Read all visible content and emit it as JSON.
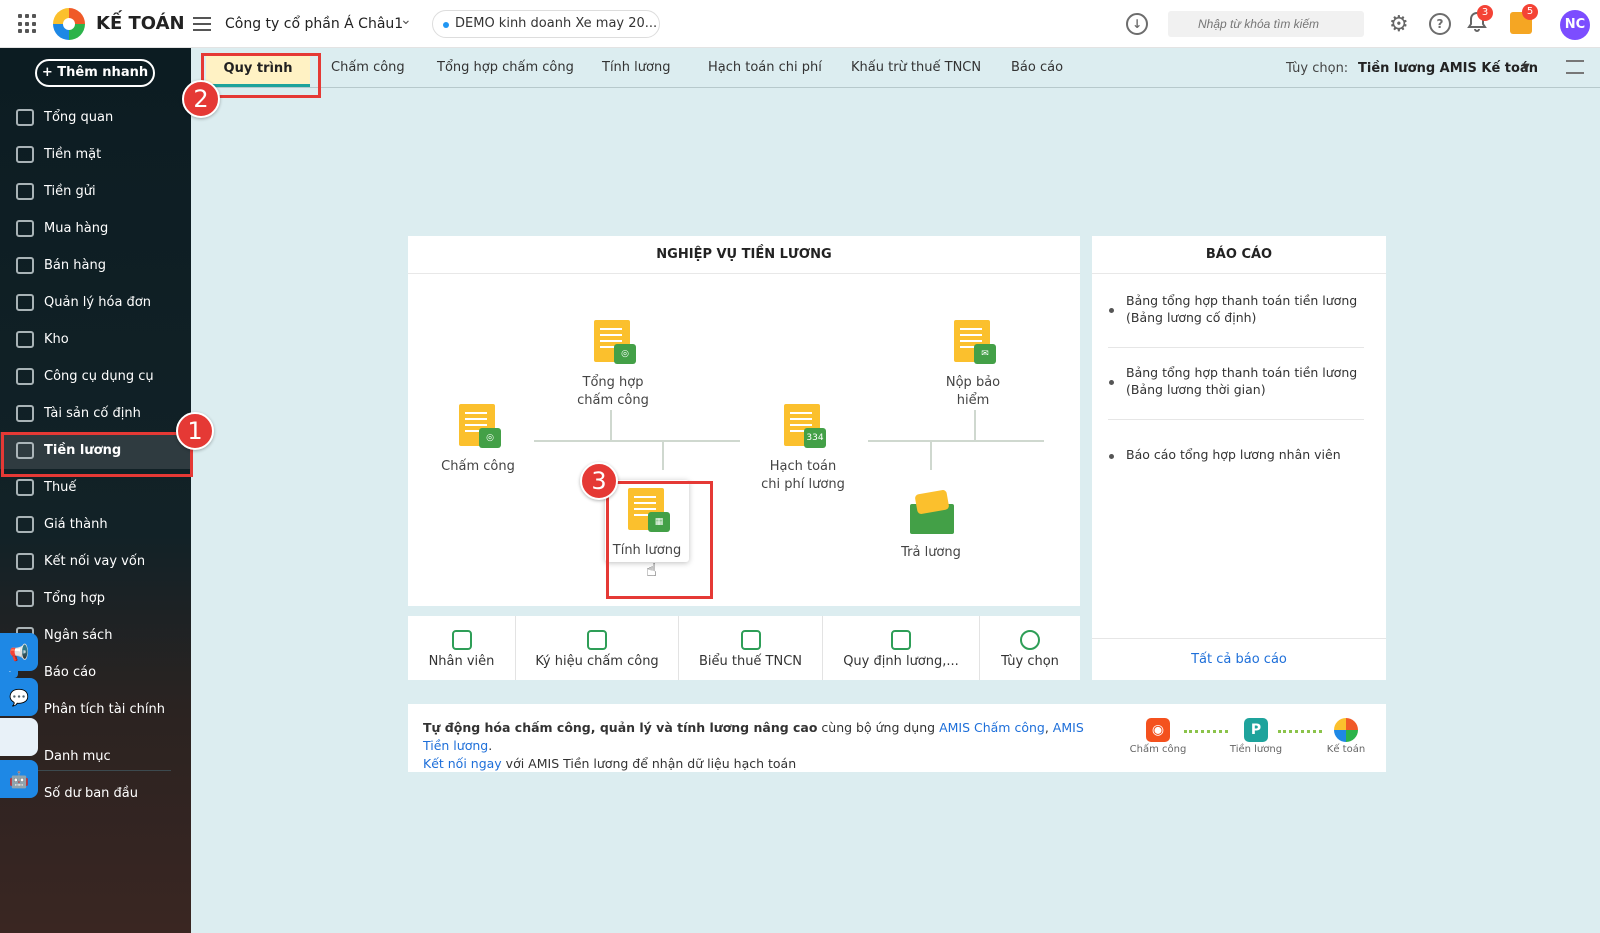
{
  "app": {
    "brand": "KẾ TOÁN",
    "company": "Công ty cổ phần Á Châu1",
    "demo_db": "DEMO kinh doanh Xe may 20..."
  },
  "search": {
    "placeholder": "Nhập từ khóa tìm kiếm"
  },
  "badges": {
    "notifications": "3",
    "gifts": "5"
  },
  "user": {
    "initials": "NC"
  },
  "sidebar": {
    "quick_add": "+ Thêm nhanh",
    "items": [
      {
        "label": "Tổng quan"
      },
      {
        "label": "Tiền mặt"
      },
      {
        "label": "Tiền gửi"
      },
      {
        "label": "Mua hàng"
      },
      {
        "label": "Bán hàng"
      },
      {
        "label": "Quản lý hóa đơn"
      },
      {
        "label": "Kho"
      },
      {
        "label": "Công cụ dụng cụ"
      },
      {
        "label": "Tài sản cố định"
      },
      {
        "label": "Tiền lương"
      },
      {
        "label": "Thuế"
      },
      {
        "label": "Giá thành"
      },
      {
        "label": "Kết nối vay vốn"
      },
      {
        "label": "Tổng hợp"
      },
      {
        "label": "Ngân sách"
      },
      {
        "label": "Báo cáo"
      },
      {
        "label": "Phân tích tài chính"
      },
      {
        "label": "Danh mục"
      },
      {
        "label": "Số dư ban đầu"
      }
    ]
  },
  "tabs": [
    "Quy trình",
    "Chấm công",
    "Tổng hợp chấm công",
    "Tính lương",
    "Hạch toán chi phí",
    "Khấu trừ thuế TNCN",
    "Báo cáo"
  ],
  "options": {
    "label": "Tùy chọn:",
    "value": "Tiền lương AMIS Kế toán"
  },
  "steps": [
    "1",
    "2",
    "3"
  ],
  "workflow": {
    "title": "NGHIỆP VỤ TIỀN LƯƠNG",
    "nodes": {
      "cham_cong": "Chấm công",
      "tong_hop_1": "Tổng hợp",
      "tong_hop_2": "chấm công",
      "tinh_luong": "Tính lương",
      "hach_toan_1": "Hạch toán",
      "hach_toan_2": "chi phí lương",
      "hach_toan_badge": "334",
      "nop_bh_1": "Nộp bảo",
      "nop_bh_2": "hiểm",
      "tra_luong": "Trả lương"
    },
    "bottom": [
      "Nhân viên",
      "Ký hiệu chấm công",
      "Biểu thuế TNCN",
      "Quy định lương,...",
      "Tùy chọn"
    ]
  },
  "reports": {
    "title": "BÁO CÁO",
    "items": [
      {
        "l1": "Bảng tổng hợp thanh toán tiền lương",
        "l2": "(Bảng lương cố định)"
      },
      {
        "l1": "Bảng tổng hợp thanh toán tiền lương",
        "l2": "(Bảng lương thời gian)"
      },
      {
        "l1": "Báo cáo tổng hợp lương nhân viên",
        "l2": ""
      }
    ],
    "all": "Tất cả báo cáo"
  },
  "promo": {
    "bold": "Tự động hóa chấm công, quản lý và tính lương nâng cao",
    "mid": " cùng bộ ứng dụng ",
    "link1": "AMIS Chấm công",
    "comma": ", ",
    "link2": "AMIS Tiền lương",
    "dot": ".",
    "connect": "Kết nối ngay",
    "rest": " với AMIS Tiền lương để nhận dữ liệu hạch toán",
    "apps": [
      "Chấm công",
      "Tiền lương",
      "Kế toán"
    ],
    "app2_letter": "P"
  },
  "colors": {
    "accent": "#1ea39c",
    "highlight": "#e53935",
    "tab_active_bg": "#fff2c4",
    "bg": "#dcedf0"
  }
}
